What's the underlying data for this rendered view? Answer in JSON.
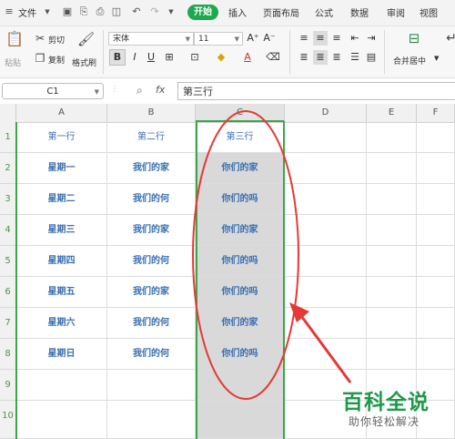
{
  "menu": {
    "file": "文件",
    "tabs": [
      "开始",
      "插入",
      "页面布局",
      "公式",
      "数据",
      "审阅",
      "视图"
    ]
  },
  "ribbon": {
    "paste": "粘贴",
    "cut": "剪切",
    "copy": "复制",
    "format_painter": "格式刷",
    "font_name": "宋体",
    "font_size": "11",
    "bold": "B",
    "merge_center": "合并居中",
    "wrap": "自动换行"
  },
  "formula_bar": {
    "name_box": "C1",
    "fx": "fx",
    "value": "第三行"
  },
  "columns": [
    "A",
    "B",
    "C",
    "D",
    "E",
    "F"
  ],
  "rows": [
    "1",
    "2",
    "3",
    "4",
    "5",
    "6",
    "7",
    "8",
    "9",
    "10"
  ],
  "table": [
    [
      "第一行",
      "第二行",
      "第三行"
    ],
    [
      "星期一",
      "我们的家",
      "你们的家"
    ],
    [
      "星期二",
      "我们的何",
      "你们的吗"
    ],
    [
      "星期三",
      "我们的家",
      "你们的家"
    ],
    [
      "星期四",
      "我们的何",
      "你们的吗"
    ],
    [
      "星期五",
      "我们的家",
      "你们的吗"
    ],
    [
      "星期六",
      "我们的何",
      "你们的家"
    ],
    [
      "星期日",
      "我们的何",
      "你们的吗"
    ]
  ],
  "watermark": {
    "brand": "百科全说",
    "slogan": "助你轻松解决"
  },
  "colors": {
    "accent_green": "#1fa84f",
    "selection_border": "#3aa64a",
    "annotation_red": "#e53935",
    "cell_text": "#3a6fb0"
  }
}
